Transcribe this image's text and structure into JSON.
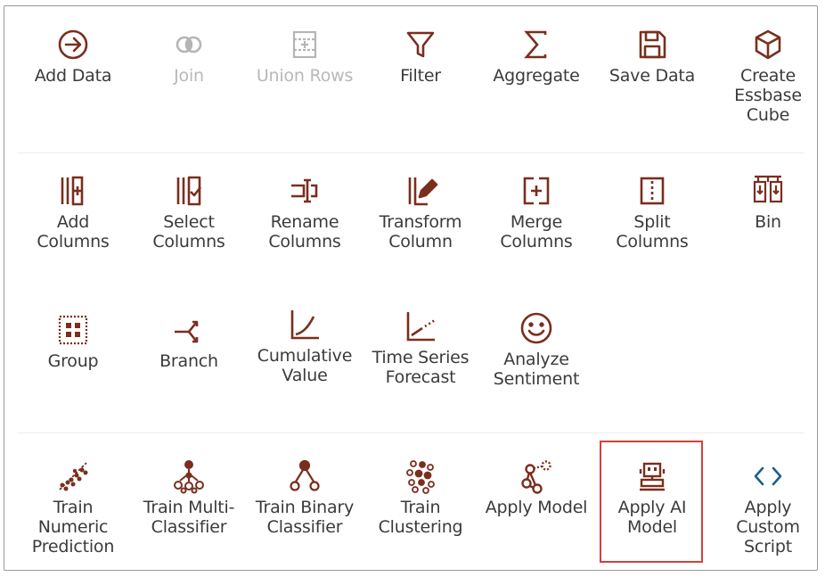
{
  "colors": {
    "icon": "#7a2e1e",
    "disabled_icon": "#b5b5b5",
    "highlight": "#d2403a"
  },
  "rows": [
    {
      "items": [
        {
          "icon": "arrow-right-circle-icon",
          "label": "Add Data",
          "disabled": false
        },
        {
          "icon": "join-icon",
          "label": "Join",
          "disabled": true
        },
        {
          "icon": "union-rows-icon",
          "label": "Union Rows",
          "disabled": true
        },
        {
          "icon": "filter-icon",
          "label": "Filter",
          "disabled": false
        },
        {
          "icon": "sigma-icon",
          "label": "Aggregate",
          "disabled": false
        },
        {
          "icon": "save-disk-icon",
          "label": "Save Data",
          "disabled": false
        },
        {
          "icon": "cube-icon",
          "label": "Create\nEssbase\nCube",
          "disabled": false
        }
      ]
    },
    {
      "items": [
        {
          "icon": "add-columns-icon",
          "label": "Add\nColumns",
          "disabled": false
        },
        {
          "icon": "select-columns-icon",
          "label": "Select\nColumns",
          "disabled": false
        },
        {
          "icon": "rename-columns-icon",
          "label": "Rename\nColumns",
          "disabled": false
        },
        {
          "icon": "transform-column-icon",
          "label": "Transform\nColumn",
          "disabled": false
        },
        {
          "icon": "merge-columns-icon",
          "label": "Merge\nColumns",
          "disabled": false
        },
        {
          "icon": "split-columns-icon",
          "label": "Split\nColumns",
          "disabled": false
        },
        {
          "icon": "bin-icon",
          "label": "Bin",
          "disabled": false
        }
      ]
    },
    {
      "items": [
        {
          "icon": "group-icon",
          "label": "Group",
          "disabled": false
        },
        {
          "icon": "branch-icon",
          "label": "Branch",
          "disabled": false
        },
        {
          "icon": "cumulative-value-icon",
          "label": "Cumulative\nValue",
          "disabled": false
        },
        {
          "icon": "time-series-forecast-icon",
          "label": "Time Series\nForecast",
          "disabled": false
        },
        {
          "icon": "smiley-icon",
          "label": "Analyze\nSentiment",
          "disabled": false
        }
      ]
    },
    {
      "items": [
        {
          "icon": "scatter-trend-icon",
          "label": "Train\nNumeric\nPrediction",
          "disabled": false
        },
        {
          "icon": "multi-classifier-icon",
          "label": "Train Multi-\nClassifier",
          "disabled": false
        },
        {
          "icon": "binary-classifier-icon",
          "label": "Train Binary\nClassifier",
          "disabled": false
        },
        {
          "icon": "clustering-icon",
          "label": "Train\nClustering",
          "disabled": false
        },
        {
          "icon": "apply-model-icon",
          "label": "Apply Model",
          "disabled": false
        },
        {
          "icon": "robot-icon",
          "label": "Apply AI\nModel",
          "disabled": false
        },
        {
          "icon": "code-brackets-icon",
          "label": "Apply\nCustom\nScript",
          "disabled": false
        }
      ]
    }
  ]
}
